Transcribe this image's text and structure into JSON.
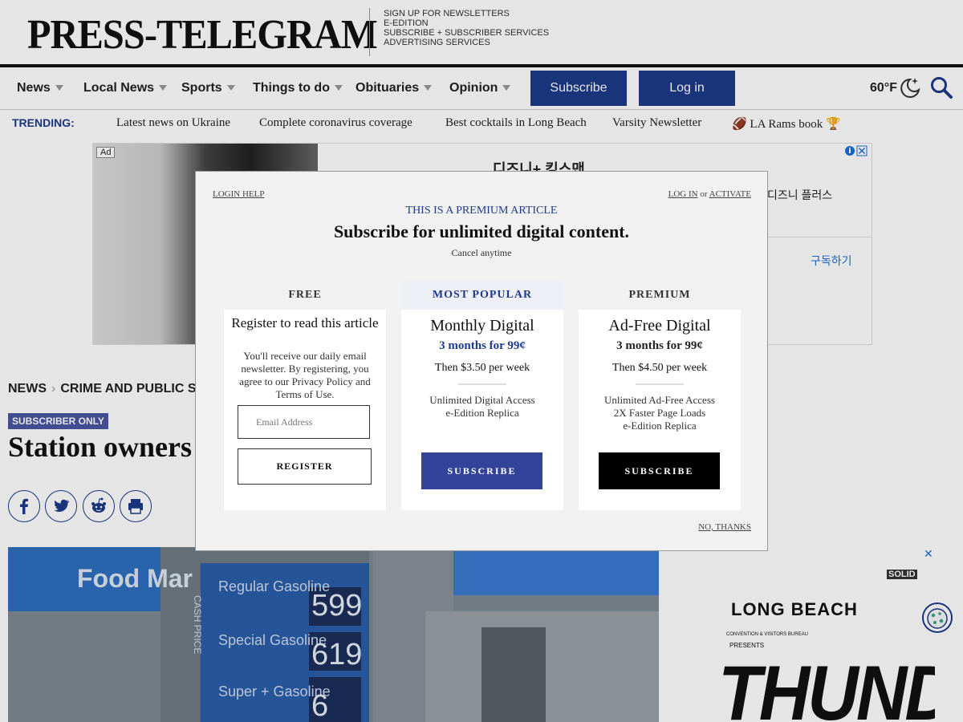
{
  "masthead": {
    "logo": "PRESS-TELEGRAM",
    "links": [
      "SIGN UP FOR NEWSLETTERS",
      "E-EDITION",
      "SUBSCRIBE + SUBSCRIBER SERVICES",
      "ADVERTISING SERVICES"
    ]
  },
  "nav": {
    "items": [
      "News",
      "Local News",
      "Sports",
      "Things to do",
      "Obituaries",
      "Opinion"
    ],
    "subscribe": "Subscribe",
    "login": "Log in",
    "weather": "60°F",
    "icons": [
      "moon-stars-icon",
      "search-icon"
    ]
  },
  "trending": {
    "label": "TRENDING:",
    "links": [
      "Latest news on Ukraine",
      "Complete coronavirus coverage",
      "Best cocktails in Long Beach",
      "Varsity Newsletter",
      "🏈 LA Rams book 🏆"
    ]
  },
  "ad": {
    "label": "Ad",
    "title": "디즈니+ 킹스맨",
    "subtitle": "디즈니 플러스",
    "cta": "구독하기"
  },
  "article": {
    "breadcrumb": [
      "NEWS",
      "CRIME AND PUBLIC SA"
    ],
    "badge": "SUBSCRIBER ONLY",
    "headline": "Station owners",
    "share": [
      "facebook-icon",
      "twitter-icon",
      "reddit-icon",
      "print-icon"
    ]
  },
  "hero_image": {
    "sign_texts": [
      "Food Mar",
      "Regular Gasoline",
      "Special Gasoline",
      "Super + Gasoline",
      "599",
      "619",
      "6",
      "CASH PRICE"
    ]
  },
  "side_ad": {
    "brand": "SOLID",
    "org1": "LONG BEACH",
    "org2": "CONVENTION & VISITORS BUREAU",
    "presents": "PRESENTS",
    "event": "THUNDER"
  },
  "modal": {
    "login_help": "LOGIN HELP",
    "login": "LOG IN",
    "or": "or",
    "activate": "ACTIVATE",
    "premium": "THIS IS A PREMIUM ARTICLE",
    "title": "Subscribe for unlimited digital content.",
    "cancel": "Cancel anytime",
    "free": {
      "head": "FREE",
      "title": "Register to read this article",
      "desc_pre": "You'll receive our daily email newsletter. By registering, you agree to our ",
      "privacy": "Privacy Policy",
      "and": " and ",
      "terms": "Terms of Use",
      "dot": ".",
      "email_placeholder": "Email Address",
      "register": "REGISTER"
    },
    "monthly": {
      "head": "MOST POPULAR",
      "name": "Monthly Digital",
      "offer": "3 months for 99¢",
      "then": "Then $3.50 per week",
      "features": [
        "Unlimited Digital Access",
        "e-Edition Replica"
      ],
      "button": "SUBSCRIBE",
      "accent": "#1e3a8a"
    },
    "adfree": {
      "head": "PREMIUM",
      "name": "Ad-Free Digital",
      "offer": "3 months for 99¢",
      "then": "Then $4.50 per week",
      "features": [
        "Unlimited Ad-Free Access",
        "2X Faster Page Loads",
        "e-Edition Replica"
      ],
      "button": "SUBSCRIBE",
      "accent": "#000000"
    },
    "no_thanks": "NO, THANKS"
  }
}
